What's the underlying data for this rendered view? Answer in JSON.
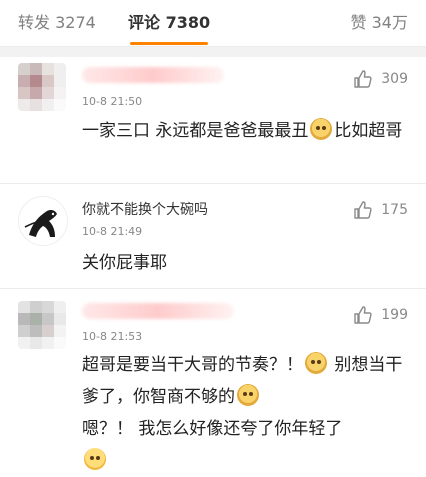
{
  "tabs": {
    "repost_label": "转发",
    "repost_count": "3274",
    "comment_label": "评论",
    "comment_count": "7380",
    "like_label": "赞",
    "like_count": "34万"
  },
  "comments": [
    {
      "time": "10-8 21:50",
      "likes": "309",
      "text_parts": [
        "一家三口 永远都是爸爸最最丑",
        "比如超哥"
      ]
    },
    {
      "name": "你就不能换个大碗吗",
      "time": "10-8 21:49",
      "likes": "175",
      "text": "关你屁事耶"
    },
    {
      "time": "10-8 21:53",
      "likes": "199",
      "text_parts": [
        "超哥是要当干大哥的节奏？！",
        "别想当干爹了，你智商不够的",
        "嗯？！ 我怎么好像还夸了你年轻了"
      ]
    }
  ],
  "icons": {
    "like": "thumbs-up-icon",
    "emoji_doge": "doge-emoji",
    "emoji_thinking": "thinking-emoji"
  }
}
